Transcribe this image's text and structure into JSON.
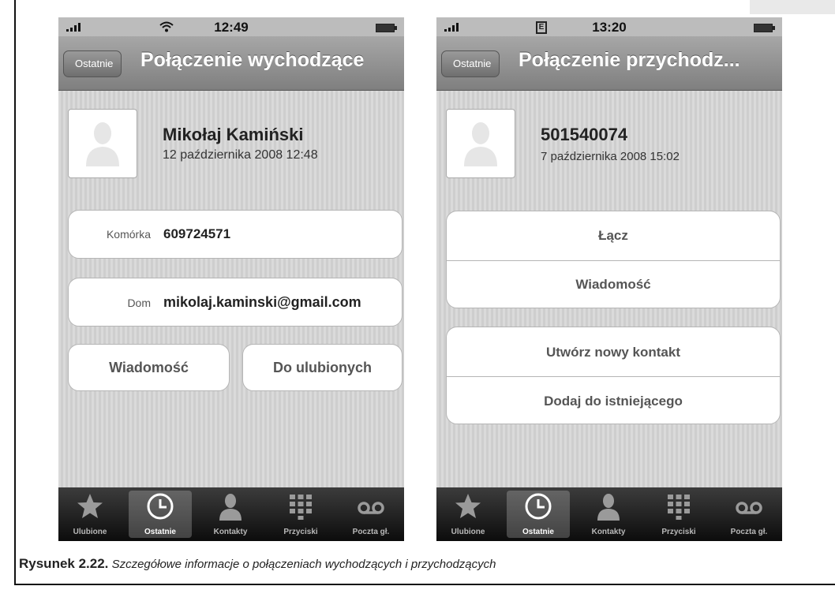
{
  "left_phone": {
    "status_time": "12:49",
    "back_label": "Ostatnie",
    "title": "Połączenie wychodzące",
    "contact_name": "Mikołaj Kamiński",
    "call_date": "12 października 2008 12:48",
    "field1_label": "Komórka",
    "field1_value": "609724571",
    "field2_label": "Dom",
    "field2_value": "mikolaj.kaminski@gmail.com",
    "button_message": "Wiadomość",
    "button_favorites": "Do ulubionych"
  },
  "right_phone": {
    "status_time": "13:20",
    "network_indicator": "E",
    "back_label": "Ostatnie",
    "title": "Połączenie przychodz...",
    "caller_number": "501540074",
    "call_date": "7 października 2008 15:02",
    "button_call": "Łącz",
    "button_message": "Wiadomość",
    "button_new_contact": "Utwórz nowy kontakt",
    "button_add_existing": "Dodaj do istniejącego"
  },
  "tabbar": {
    "items": [
      {
        "label": "Ulubione",
        "icon": "star-icon"
      },
      {
        "label": "Ostatnie",
        "icon": "clock-icon",
        "active": true
      },
      {
        "label": "Kontakty",
        "icon": "person-icon"
      },
      {
        "label": "Przyciski",
        "icon": "keypad-icon"
      },
      {
        "label": "Poczta gł.",
        "icon": "voicemail-icon"
      }
    ]
  },
  "caption": {
    "number": "Rysunek 2.22.",
    "text": "Szczegółowe informacje o połączeniach wychodzących i przychodzących"
  }
}
